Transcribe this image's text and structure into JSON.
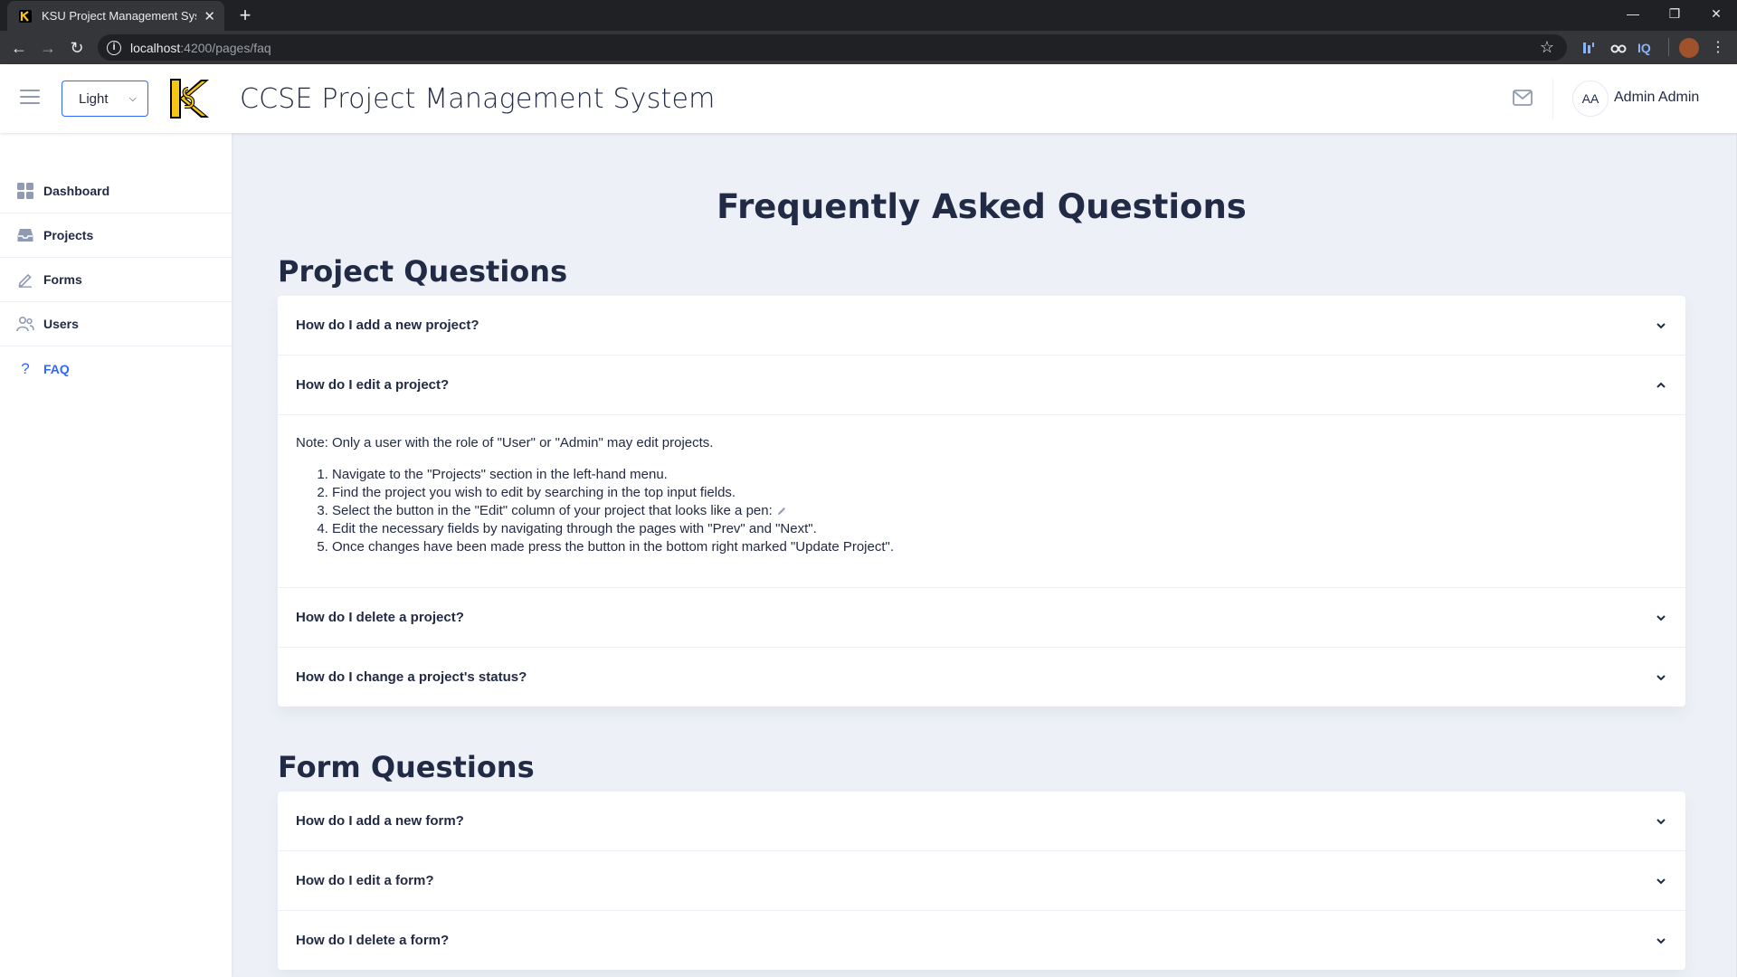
{
  "browser": {
    "tab_title": "KSU Project Management System",
    "tab_close": "✕",
    "new_tab": "+",
    "url_host": "localhost",
    "url_path": ":4200/pages/faq",
    "extensions": [
      "IQ"
    ]
  },
  "header": {
    "theme_selected": "Light",
    "title": "CCSE Project Management System",
    "avatar_initials": "AA",
    "user_name": "Admin Admin"
  },
  "sidebar": {
    "items": [
      {
        "label": "Dashboard",
        "icon": "grid-icon"
      },
      {
        "label": "Projects",
        "icon": "inbox-icon"
      },
      {
        "label": "Forms",
        "icon": "edit-icon"
      },
      {
        "label": "Users",
        "icon": "people-icon"
      },
      {
        "label": "FAQ",
        "icon": "question-mark-icon",
        "active": true
      }
    ]
  },
  "main": {
    "page_title": "Frequently Asked Questions",
    "sections": [
      {
        "title": "Project Questions",
        "questions": [
          {
            "q": "How do I add a new project?",
            "expanded": false
          },
          {
            "q": "How do I edit a project?",
            "expanded": true,
            "note": "Note: Only a user with the role of \"User\" or \"Admin\" may edit projects.",
            "steps": [
              "Navigate to the \"Projects\" section in the left-hand menu.",
              "Find the project you wish to edit by searching in the top input fields.",
              "Select the button in the \"Edit\" column of your project that looks like a pen:",
              "Edit the necessary fields by navigating through the pages with \"Prev\" and \"Next\".",
              "Once changes have been made press the button in the bottom right marked \"Update Project\"."
            ]
          },
          {
            "q": "How do I delete a project?",
            "expanded": false
          },
          {
            "q": "How do I change a project's status?",
            "expanded": false
          }
        ]
      },
      {
        "title": "Form Questions",
        "questions": [
          {
            "q": "How do I add a new form?",
            "expanded": false
          },
          {
            "q": "How do I edit a form?",
            "expanded": false
          },
          {
            "q": "How do I delete a form?",
            "expanded": false
          }
        ]
      }
    ]
  },
  "colors": {
    "accent": "#3366ff",
    "text": "#222b45",
    "background": "#edf1f7",
    "logo_gold": "#f5c518"
  }
}
